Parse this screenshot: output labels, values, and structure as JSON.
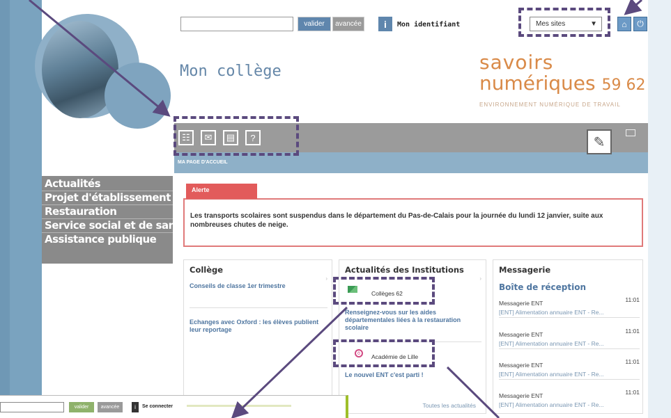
{
  "search": {
    "placeholder": "",
    "valider": "valider",
    "avance": "avancée"
  },
  "header": {
    "info_icon": "i",
    "identifiant": "Mon identifiant"
  },
  "mes_sites": {
    "selected": "Mes sites"
  },
  "site_title": "Mon collège",
  "brand": {
    "line1": "savoirs",
    "line2": "numériques",
    "num": "59 62",
    "tagline": "ENVIRONNEMENT NUMÉRIQUE DE TRAVAIL"
  },
  "breadcrumb": "MA PAGE D'ACCUEIL",
  "menu": {
    "items": [
      "Actualités",
      "Projet d'établissement",
      "Restauration",
      "Service social et de santé",
      "Assistance publique"
    ]
  },
  "alert": {
    "tab": "Alerte",
    "text": "Les transports scolaires sont suspendus dans le département du Pas-de-Calais pour la journée du lundi 12 janvier, suite aux nombreuses chutes de neige."
  },
  "col_college": {
    "title": "Collège",
    "items": [
      "Conseils de classe 1er trimestre",
      "Echanges avec Oxford : les élèves publient leur reportage"
    ]
  },
  "col_actu": {
    "title": "Actualités des Institutions",
    "colleges": "Collèges 62",
    "link1": "Renseignez-vous sur les aides départementales liées à la restauration scolaire",
    "academie": "Académie de Lille",
    "link2": "Le nouvel ENT c'est parti !",
    "all": "Toutes les actualités"
  },
  "col_msg": {
    "title": "Messagerie",
    "subtitle": "Boîte de réception",
    "messages": [
      {
        "from": "Messagerie ENT",
        "time": "11:01",
        "subject": "[ENT] Alimentation annuaire ENT - Re..."
      },
      {
        "from": "Messagerie ENT",
        "time": "11:01",
        "subject": "[ENT] Alimentation annuaire ENT - Re..."
      },
      {
        "from": "Messagerie ENT",
        "time": "11:01",
        "subject": "[ENT] Alimentation annuaire ENT - Re..."
      },
      {
        "from": "Messagerie ENT",
        "time": "11:01",
        "subject": "[ENT] Alimentation annuaire ENT - Re..."
      }
    ]
  },
  "inset": {
    "valider": "valider",
    "avance": "avancée",
    "info": "i",
    "connect": "Se connecter"
  },
  "colors": {
    "accent_blue": "#5f86ad",
    "brand_orange": "#d98a48",
    "alert_red": "#e25b5b",
    "menu_gray": "#8a8a8a",
    "annotation_purple": "#5b4a7e"
  }
}
